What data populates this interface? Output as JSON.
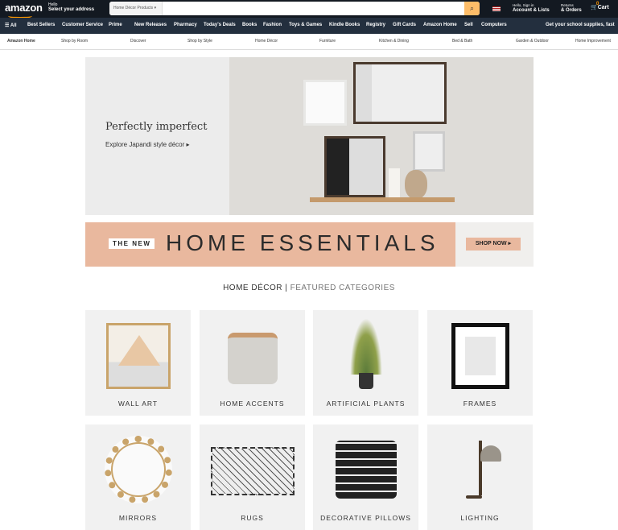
{
  "header": {
    "logo": "amazon",
    "hello": "Hello",
    "address": "Select your address",
    "search_category": "Home Décor Products",
    "search_placeholder": "",
    "account_hello": "Hello, Sign in",
    "account": "Account & Lists",
    "returns": "Returns",
    "orders": "& Orders",
    "cart_count": "0",
    "cart": "Cart"
  },
  "nav": {
    "all": "All",
    "items": [
      "Best Sellers",
      "Customer Service",
      "Prime",
      "New Releases",
      "Pharmacy",
      "Today's Deals",
      "Books",
      "Fashion",
      "Toys & Games",
      "Kindle Books",
      "Registry",
      "Gift Cards",
      "Amazon Home",
      "Sell",
      "Computers"
    ],
    "promo": "Get your school supplies, fast"
  },
  "subnav": [
    "Amazon Home",
    "Shop by Room",
    "Discover",
    "Shop by Style",
    "Home Décor",
    "Furniture",
    "Kitchen & Dining",
    "Bed & Bath",
    "Garden & Outdoor",
    "Home Improvement"
  ],
  "hero": {
    "title": "Perfectly imperfect",
    "link": "Explore Japandi style décor ▸"
  },
  "banner": {
    "tag": "THE NEW",
    "title": "HOME ESSENTIALS",
    "button": "SHOP NOW ▸",
    "color": "#e9b89e"
  },
  "section": {
    "title": "HOME DÉCOR",
    "sep": "|",
    "subtitle": "FEATURED CATEGORIES"
  },
  "categories": [
    {
      "label": "WALL ART"
    },
    {
      "label": "HOME ACCENTS"
    },
    {
      "label": "ARTIFICIAL PLANTS"
    },
    {
      "label": "FRAMES"
    },
    {
      "label": "MIRRORS"
    },
    {
      "label": "RUGS"
    },
    {
      "label": "DECORATIVE PILLOWS"
    },
    {
      "label": "LIGHTING"
    }
  ]
}
